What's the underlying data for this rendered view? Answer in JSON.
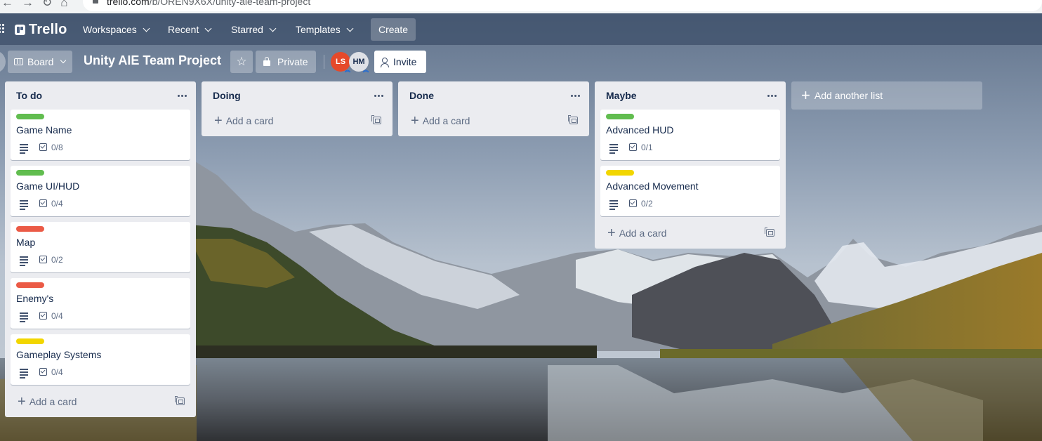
{
  "browser": {
    "url_host": "trello.com",
    "url_path": "/b/OREN9X6X/unity-aie-team-project"
  },
  "header": {
    "logo": "Trello",
    "nav": [
      {
        "label": "Workspaces"
      },
      {
        "label": "Recent"
      },
      {
        "label": "Starred"
      },
      {
        "label": "Templates"
      }
    ],
    "create_label": "Create"
  },
  "board": {
    "view_label": "Board",
    "title": "Unity AIE Team Project",
    "visibility_label": "Private",
    "members": [
      {
        "initials": "LS",
        "color": "#e5492a"
      },
      {
        "initials": "HM",
        "color": "#dfe1e6"
      }
    ],
    "invite_label": "Invite"
  },
  "lists": [
    {
      "title": "To do",
      "cards": [
        {
          "label_color": "#61bd4f",
          "title": "Game Name",
          "checklist": "0/8"
        },
        {
          "label_color": "#61bd4f",
          "title": "Game UI/HUD",
          "checklist": "0/4"
        },
        {
          "label_color": "#eb5a46",
          "title": "Map",
          "checklist": "0/2"
        },
        {
          "label_color": "#eb5a46",
          "title": "Enemy's",
          "checklist": "0/4"
        },
        {
          "label_color": "#f2d600",
          "title": "Gameplay Systems",
          "checklist": "0/4"
        }
      ],
      "add_card_label": "Add a card"
    },
    {
      "title": "Doing",
      "cards": [],
      "add_card_label": "Add a card"
    },
    {
      "title": "Done",
      "cards": [],
      "add_card_label": "Add a card"
    },
    {
      "title": "Maybe",
      "cards": [
        {
          "label_color": "#61bd4f",
          "title": "Advanced HUD",
          "checklist": "0/1"
        },
        {
          "label_color": "#f2d600",
          "title": "Advanced Movement",
          "checklist": "0/2"
        }
      ],
      "add_card_label": "Add a card"
    }
  ],
  "add_list_label": "Add another list"
}
